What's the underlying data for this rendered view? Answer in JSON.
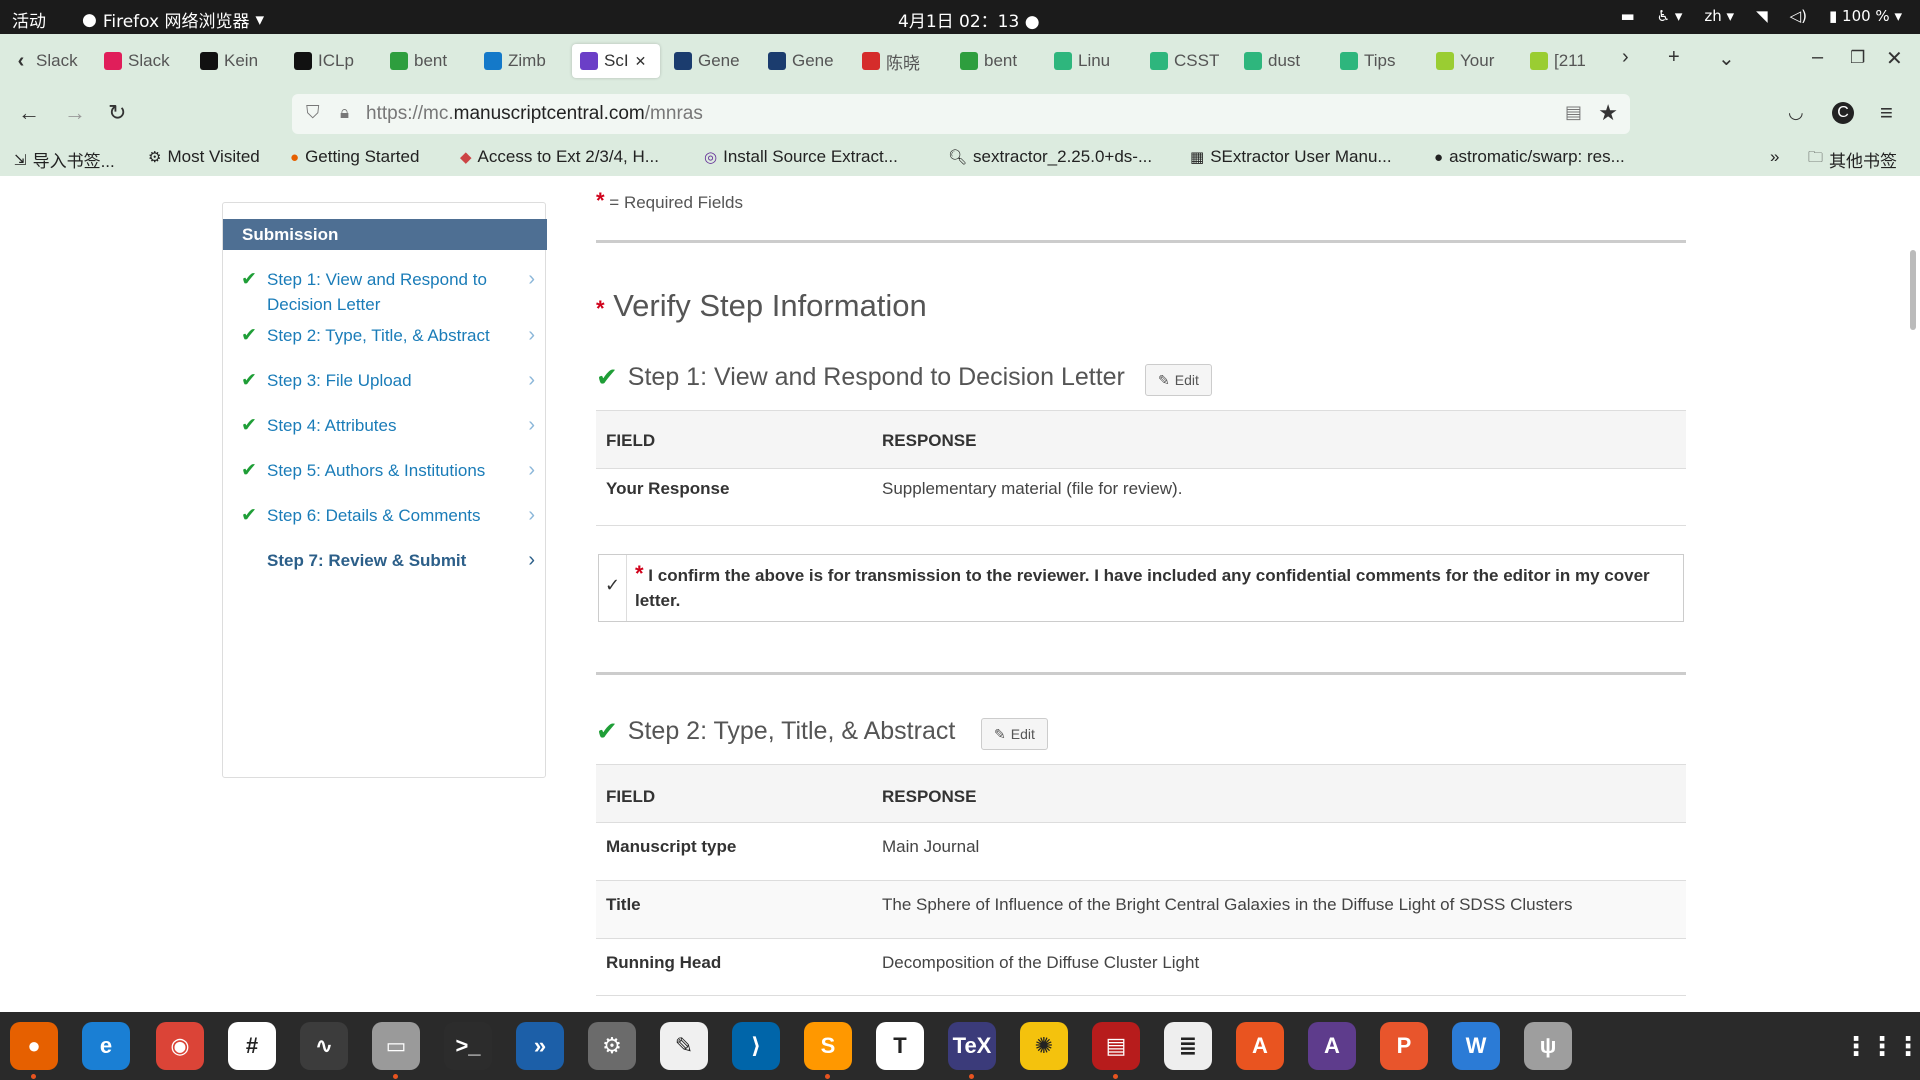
{
  "topbar": {
    "activities": "活动",
    "app_name": "Firefox 网络浏览器",
    "clock": "4月1日  02：13  ●",
    "lang": "zh ▾",
    "battery": "100 %"
  },
  "tabs": [
    {
      "label": "Slack",
      "icon": "back-chevron-icon",
      "color": "#555"
    },
    {
      "label": "Slack",
      "icon": "slack-icon",
      "color": "#e01e5a"
    },
    {
      "label": "Kein",
      "icon": "github-icon",
      "color": "#111"
    },
    {
      "label": "ICLp",
      "icon": "github-icon",
      "color": "#111"
    },
    {
      "label": "bent",
      "icon": "grass-icon",
      "color": "#2e9e3e"
    },
    {
      "label": "Zimb",
      "icon": "zimbra-icon",
      "color": "#1479c9"
    },
    {
      "label": "ScI",
      "icon": "scholarone-icon",
      "color": "#6b3fc7"
    },
    {
      "label": "Gene",
      "icon": "gene-icon",
      "color": "#1b3c6e"
    },
    {
      "label": "Gene",
      "icon": "gene-icon",
      "color": "#1b3c6e"
    },
    {
      "label": "陈晓",
      "icon": "weibo-icon",
      "color": "#d52c2b"
    },
    {
      "label": "bent",
      "icon": "grass-icon",
      "color": "#2e9e3e"
    },
    {
      "label": "Linu",
      "icon": "pen-icon",
      "color": "#2eb67d"
    },
    {
      "label": "CSST",
      "icon": "pen-icon",
      "color": "#2eb67d"
    },
    {
      "label": "dust",
      "icon": "pen-icon",
      "color": "#2eb67d"
    },
    {
      "label": "Tips",
      "icon": "pen-icon",
      "color": "#2eb67d"
    },
    {
      "label": "Your",
      "icon": "smiley-icon",
      "color": "#9acd32"
    },
    {
      "label": "[211",
      "icon": "smiley-icon",
      "color": "#9acd32"
    }
  ],
  "url": {
    "prefix": "https://mc.",
    "host": "manuscriptcentral.com",
    "path": "/mnras"
  },
  "bookmarks": [
    {
      "label": "导入书签...",
      "icon": "import-icon"
    },
    {
      "label": "Most Visited",
      "icon": "gear-icon"
    },
    {
      "label": "Getting Started",
      "icon": "firefox-icon"
    },
    {
      "label": "Access to Ext 2/3/4, H...",
      "icon": "drive-icon"
    },
    {
      "label": "Install Source Extract...",
      "icon": "source-icon"
    },
    {
      "label": "sextractor_2.25.0+ds-...",
      "icon": "search-icon"
    },
    {
      "label": "SExtractor User Manu...",
      "icon": "doc-icon"
    },
    {
      "label": "astromatic/swarp: res...",
      "icon": "github-icon"
    },
    {
      "label": "其他书签",
      "icon": "folder-icon"
    }
  ],
  "sidebar": {
    "header": "Submission",
    "items": [
      {
        "label": "Step 1: View and Respond to Decision Letter",
        "done": true
      },
      {
        "label": "Step 2: Type, Title, & Abstract",
        "done": true
      },
      {
        "label": "Step 3: File Upload",
        "done": true
      },
      {
        "label": "Step 4: Attributes",
        "done": true
      },
      {
        "label": "Step 5: Authors & Institutions",
        "done": true
      },
      {
        "label": "Step 6: Details & Comments",
        "done": true
      },
      {
        "label": "Step 7: Review & Submit",
        "done": false
      }
    ]
  },
  "main": {
    "required_note": "= Required Fields",
    "verify_heading": "Verify Step Information",
    "edit_label": "Edit",
    "field_header": "FIELD",
    "response_header": "RESPONSE",
    "step1": {
      "title": "Step 1: View and Respond to Decision Letter",
      "rows": [
        {
          "field": "Your Response",
          "response": "Supplementary material (file for review)."
        }
      ],
      "confirm_text": "I confirm the above is for transmission to the reviewer. I have included any confidential comments for the editor in my cover letter.",
      "confirm_mark": "✓"
    },
    "step2": {
      "title": "Step 2: Type, Title, & Abstract",
      "rows": [
        {
          "field": "Manuscript type",
          "response": "Main Journal"
        },
        {
          "field": "Title",
          "response": "The Sphere of Influence of the Bright Central Galaxies in the Diffuse Light of SDSS Clusters"
        },
        {
          "field": "Running Head",
          "response": "Decomposition of the Diffuse Cluster Light"
        }
      ]
    }
  },
  "dock": [
    {
      "name": "firefox-icon",
      "color": "#e66000",
      "glyph": "●"
    },
    {
      "name": "edge-icon",
      "color": "#1a7fd4",
      "glyph": "e"
    },
    {
      "name": "chrome-icon",
      "color": "#db4437",
      "glyph": "◉"
    },
    {
      "name": "slack-icon",
      "color": "#ffffff",
      "glyph": "#"
    },
    {
      "name": "system-monitor-icon",
      "color": "#3c3c3c",
      "glyph": "∿"
    },
    {
      "name": "files-icon",
      "color": "#9a9a9a",
      "glyph": "▭"
    },
    {
      "name": "terminal-icon",
      "color": "#2c2c2c",
      "glyph": ">_"
    },
    {
      "name": "remote-icon",
      "color": "#1c5fa8",
      "glyph": "»"
    },
    {
      "name": "settings-icon",
      "color": "#6b6b6b",
      "glyph": "⚙"
    },
    {
      "name": "text-editor-icon",
      "color": "#f0f0f0",
      "glyph": "✎"
    },
    {
      "name": "vscode-icon",
      "color": "#0065a9",
      "glyph": "⟩"
    },
    {
      "name": "sublime-icon",
      "color": "#ff9800",
      "glyph": "S"
    },
    {
      "name": "typora-icon",
      "color": "#ffffff",
      "glyph": "T"
    },
    {
      "name": "texstudio-icon",
      "color": "#3b3b7a",
      "glyph": "TeX"
    },
    {
      "name": "ds9-icon",
      "color": "#f4c20d",
      "glyph": "✺"
    },
    {
      "name": "window-app-icon",
      "color": "#b71c1c",
      "glyph": "▤"
    },
    {
      "name": "document-viewer-icon",
      "color": "#eeeeee",
      "glyph": "≣"
    },
    {
      "name": "app-store-icon",
      "color": "#e95420",
      "glyph": "A"
    },
    {
      "name": "astro-app-icon",
      "color": "#5e3c8c",
      "glyph": "A"
    },
    {
      "name": "presentation-icon",
      "color": "#e8552c",
      "glyph": "P"
    },
    {
      "name": "writer-icon",
      "color": "#2b7bd6",
      "glyph": "W"
    },
    {
      "name": "usb-icon",
      "color": "#9e9e9e",
      "glyph": "ψ"
    }
  ]
}
